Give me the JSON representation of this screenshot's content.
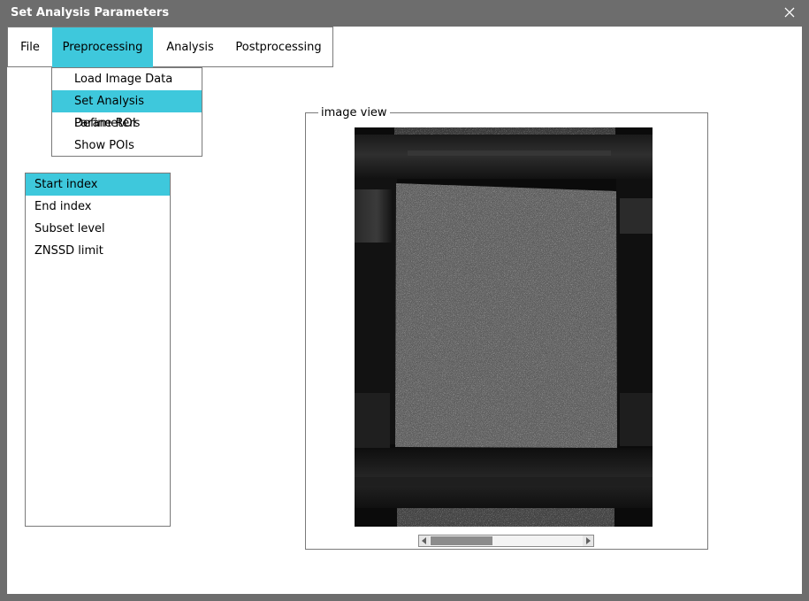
{
  "window": {
    "title": "Set Analysis Parameters",
    "close_icon": "close-icon"
  },
  "menubar": {
    "items": [
      {
        "label": "File"
      },
      {
        "label": "Preprocessing",
        "active": true
      },
      {
        "label": "Analysis"
      },
      {
        "label": "Postprocessing"
      }
    ]
  },
  "dropdown": {
    "items": [
      {
        "label": "Load Image Data"
      },
      {
        "label": "Set Analysis Parameters",
        "active": true
      },
      {
        "label": "Define ROI"
      },
      {
        "label": "Show POIs"
      }
    ]
  },
  "param_list": {
    "items": [
      {
        "label": "Start index",
        "active": true
      },
      {
        "label": "End index"
      },
      {
        "label": "Subset level"
      },
      {
        "label": "ZNSSD limit"
      }
    ]
  },
  "image_view": {
    "label": "image view",
    "image_description": "grayscale speckle-pattern specimen image"
  },
  "colors": {
    "accent": "#3ec8dc",
    "titlebar": "#6d6d6d",
    "border": "#7a7a7a"
  }
}
